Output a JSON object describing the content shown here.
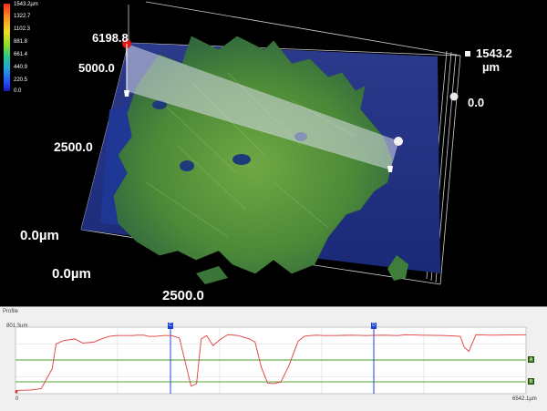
{
  "color_scale": {
    "ticks": [
      "1543.2µm",
      "1322.7",
      "1102.3",
      "881.8",
      "661.4",
      "440.9",
      "220.5",
      "0.0"
    ]
  },
  "view3d": {
    "y_max_label": "6198.8",
    "y_5000": "5000.0",
    "y_2500": "2500.0",
    "y_origin": "0.0µm",
    "x_origin": "0.0µm",
    "x_2500": "2500.0",
    "z_max_value": "1543.2",
    "z_unit": "µm",
    "z_min": "0.0"
  },
  "profile": {
    "title": "Profile",
    "y_top_label": "801.3µm",
    "x_start": "0",
    "x_end": "6542.1µm",
    "cursor_c": "C",
    "cursor_d": "D",
    "ref_a": "A",
    "ref_b": "B",
    "colors": {
      "trace": "#e03a3a",
      "ref_line": "#5aa53a",
      "cursor": "#2040e0"
    }
  },
  "chart_data": {
    "type": "line",
    "title": "Profile",
    "xlabel": "",
    "ylabel": "",
    "xlim": [
      0,
      6542.1
    ],
    "ylim": [
      0,
      801.3
    ],
    "series": [
      {
        "values_x": [
          0,
          200,
          330,
          470,
          520,
          620,
          760,
          860,
          1000,
          1100,
          1200,
          1300,
          1420,
          1500,
          1560,
          1650,
          1700,
          1800,
          1900,
          2000,
          2100,
          2250,
          2320,
          2380,
          2450,
          2530,
          2620,
          2720,
          2850,
          3000,
          3070,
          3150,
          3230,
          3300,
          3400,
          3500,
          3620,
          3700,
          3780,
          3850,
          3950,
          4100,
          4300,
          4500,
          4700,
          4900,
          5000,
          5200,
          5500,
          5700,
          5750,
          5810,
          5900,
          6100,
          6542.1
        ],
        "values_y": [
          40,
          45,
          60,
          300,
          600,
          640,
          660,
          610,
          620,
          660,
          690,
          700,
          700,
          700,
          705,
          705,
          690,
          690,
          700,
          700,
          670,
          90,
          120,
          660,
          700,
          580,
          650,
          710,
          700,
          660,
          620,
          320,
          130,
          120,
          140,
          330,
          630,
          690,
          700,
          705,
          700,
          700,
          705,
          700,
          705,
          700,
          710,
          705,
          700,
          690,
          560,
          510,
          710,
          705,
          710
        ]
      }
    ]
  }
}
